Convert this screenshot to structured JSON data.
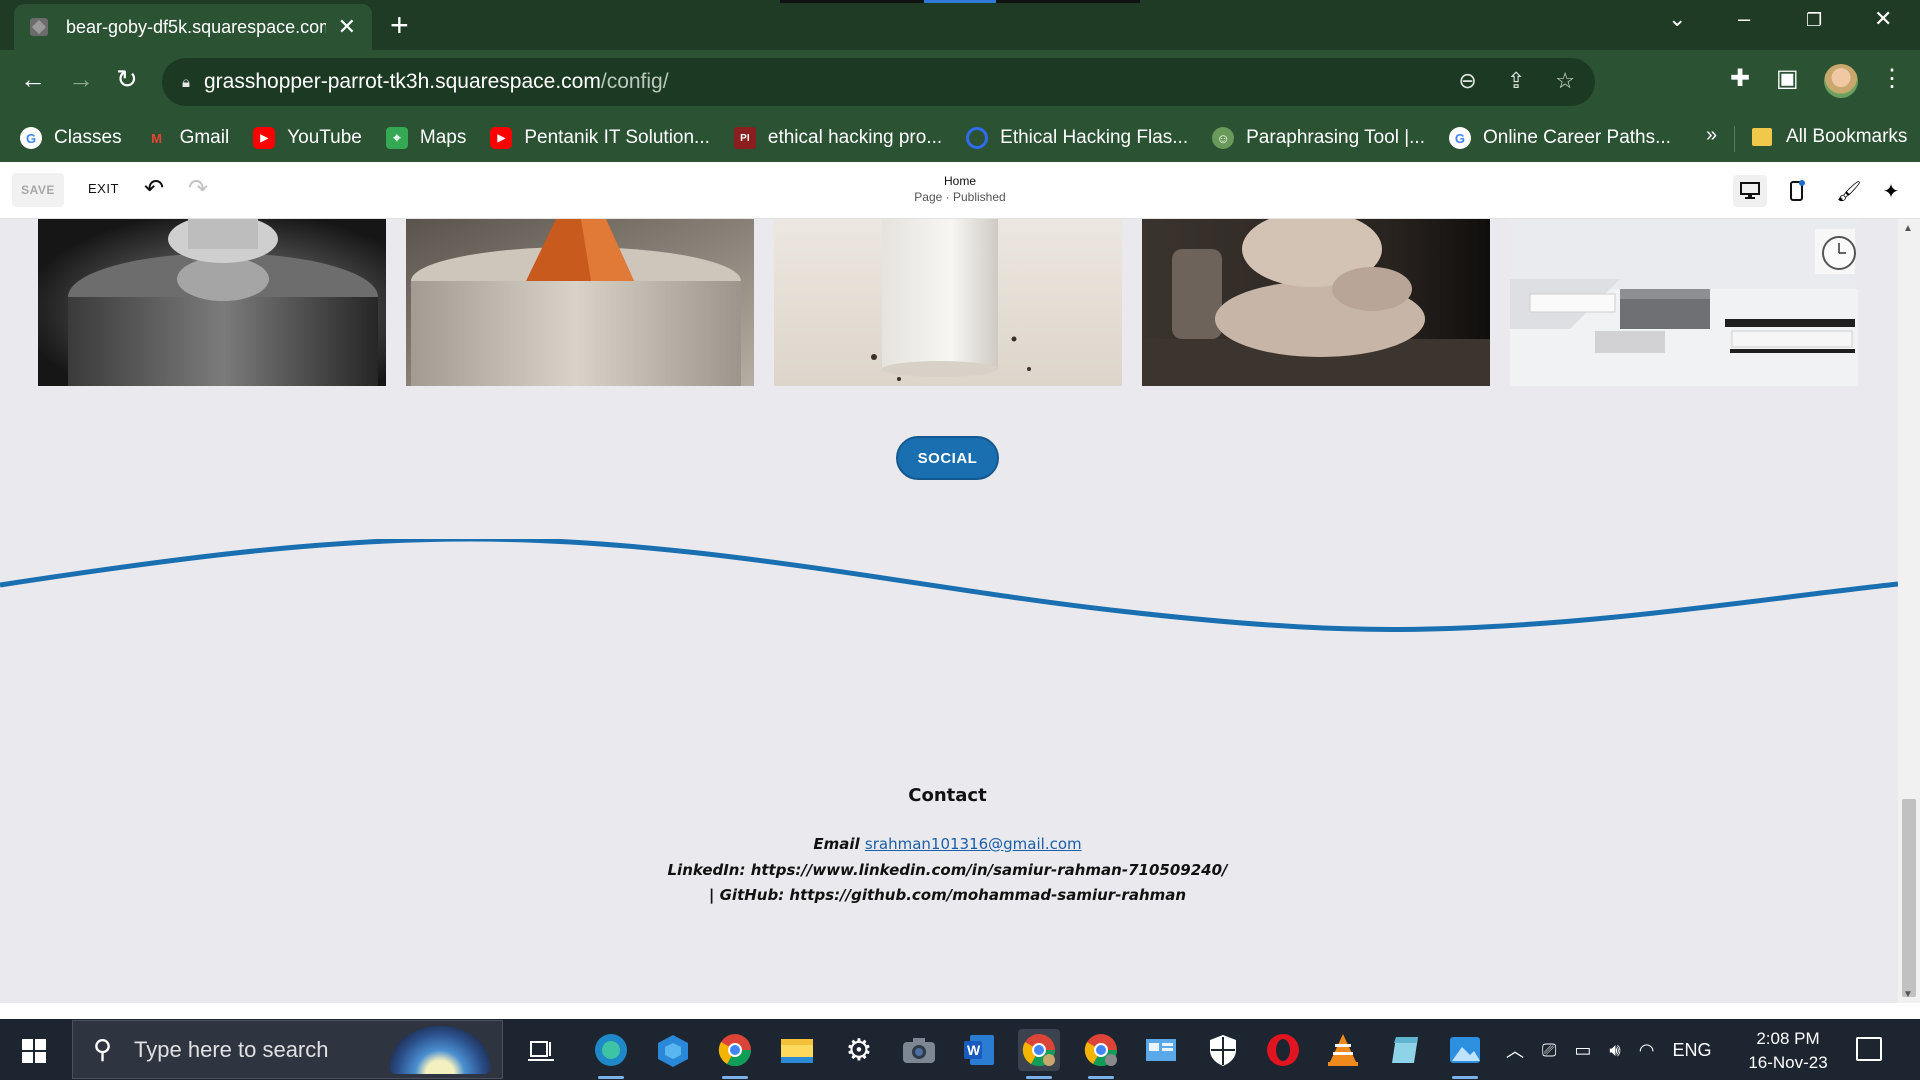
{
  "browser": {
    "tab": {
      "title": "bear-goby-df5k.squarespace.com",
      "close_icon": "close-icon"
    },
    "new_tab_label": "+",
    "window_controls": [
      "chevron-down-icon",
      "minimize-icon",
      "restore-icon",
      "close-icon"
    ],
    "address": {
      "host": "grasshopper-parrot-tk3h.squarespace.com",
      "path": "/config/"
    },
    "bookmarks": [
      {
        "label": "Classes",
        "icon": "google-icon",
        "color": "#ffffff"
      },
      {
        "label": "Gmail",
        "icon": "gmail-icon",
        "color": "#ea4335"
      },
      {
        "label": "YouTube",
        "icon": "youtube-icon",
        "color": "#ff0000"
      },
      {
        "label": "Maps",
        "icon": "maps-icon",
        "color": "#34a853"
      },
      {
        "label": "Pentanik IT Solution...",
        "icon": "youtube-icon",
        "color": "#ff0000"
      },
      {
        "label": "ethical hacking pro...",
        "icon": "site-icon",
        "color": "#8b1e1e"
      },
      {
        "label": "Ethical Hacking Flas...",
        "icon": "quillbot-icon",
        "color": "#2f6cf0"
      },
      {
        "label": "Paraphrasing Tool |...",
        "icon": "robot-icon",
        "color": "#6a9a5a"
      },
      {
        "label": "Online Career Paths...",
        "icon": "google-icon",
        "color": "#ffffff"
      }
    ],
    "more_bookmarks": "»",
    "all_bookmarks": "All Bookmarks"
  },
  "editor": {
    "save_label": "SAVE",
    "exit_label": "EXIT",
    "page_name": "Home",
    "page_status": "Page · Published"
  },
  "page": {
    "social_button": "SOCIAL",
    "contact_title": "Contact",
    "email_label": "Email",
    "email_value": "srahman101316@gmail.com",
    "linkedin_line": "LinkedIn: https://www.linkedin.com/in/samiur-rahman-710509240/",
    "github_line": "| GitHub: https://github.com/mohammad-samiur-rahman",
    "accent_color": "#1a6fb0"
  },
  "taskbar": {
    "search_placeholder": "Type here to search",
    "language": "ENG",
    "time": "2:08 PM",
    "date": "16-Nov-23"
  }
}
